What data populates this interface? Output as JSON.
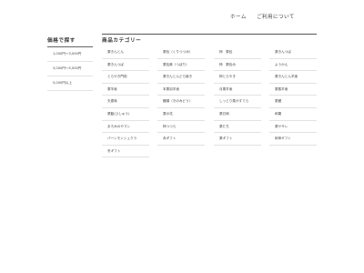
{
  "nav": {
    "home": "ホーム",
    "guide": "ご利用について"
  },
  "sidebar": {
    "title": "価格で探す",
    "items": [
      "1,000円～3,000円",
      "3,000円～5,000円",
      "5,000円以上"
    ]
  },
  "main": {
    "title": "商品カテゴリー",
    "categories": [
      "栗きんとん",
      "栗包（くりつつみ）",
      "柿　栗包",
      "栗きんつば",
      "栗きんつば",
      "栗包美（つぼり）",
      "柿　栗包み",
      "ようかん",
      "とらやき門前",
      "栗きんとんどら焼き",
      "柿とらやき",
      "栗きんとん羊羹",
      "栗羊羹",
      "本栗羽羊羹",
      "月栗羊羹",
      "栗蒸羊羹",
      "天恵味",
      "鰻頭（きのみどう）",
      "しっとり栗かすてら",
      "栗饅",
      "栗餡(ひしゅう)",
      "栗の花",
      "栗日和",
      "和菓",
      "まろみのやマン",
      "柿つつら",
      "栗たち",
      "栗ササレ",
      "バーンモンシュクラ",
      "赤ギフト",
      "栗ギフト",
      "和申ギフト",
      "冬ギフト"
    ]
  }
}
